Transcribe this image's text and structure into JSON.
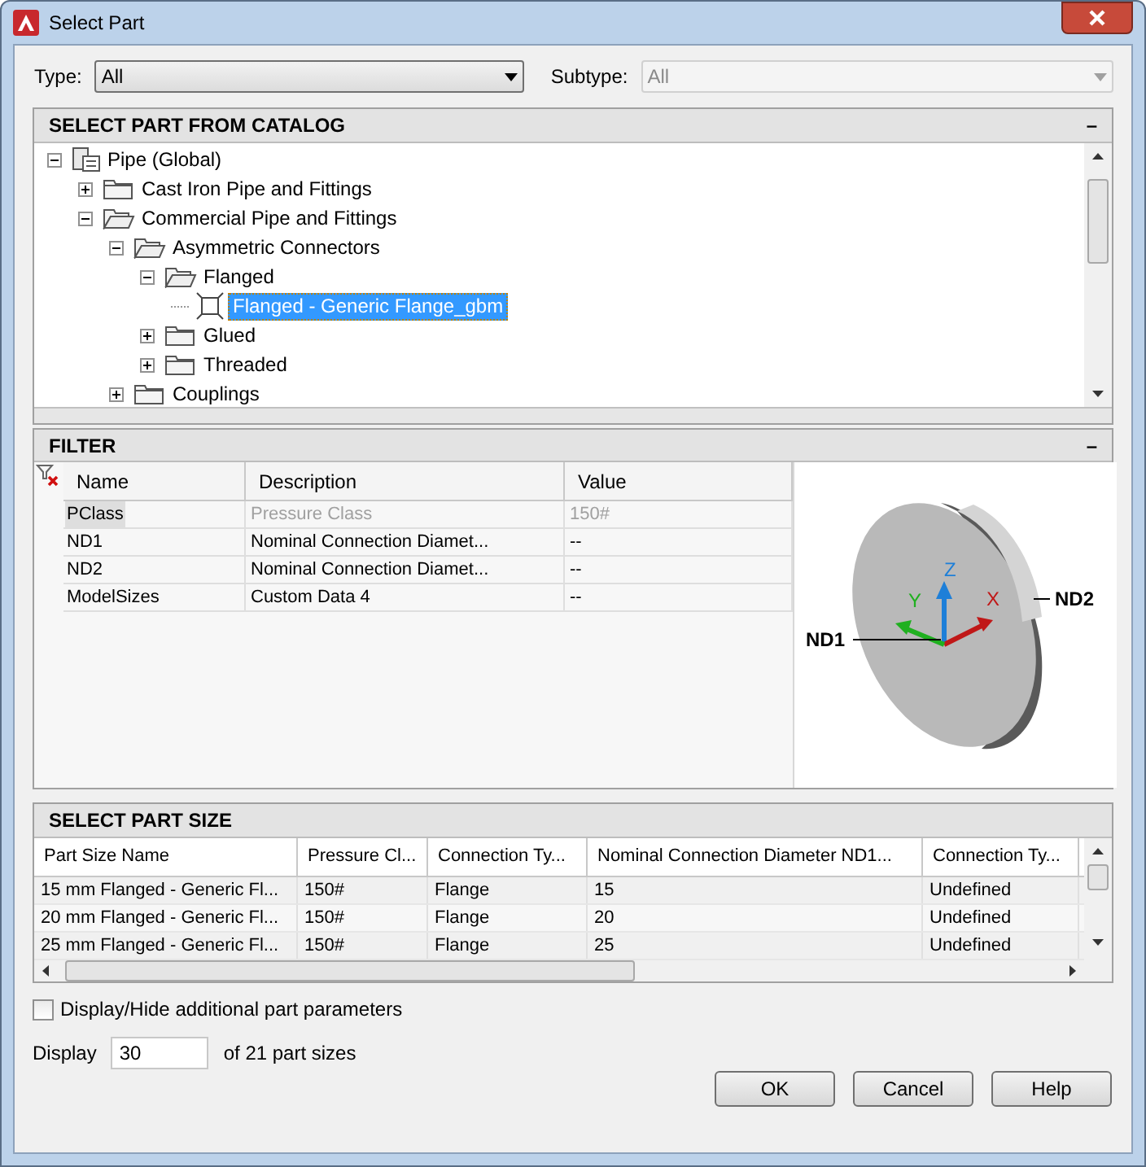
{
  "window": {
    "title": "Select Part"
  },
  "type": {
    "label": "Type:",
    "value": "All"
  },
  "subtype": {
    "label": "Subtype:",
    "value": "All",
    "disabled": true
  },
  "catalog": {
    "title": "SELECT PART FROM CATALOG",
    "collapse": "–",
    "tree": [
      {
        "label": "Pipe (Global)",
        "kind": "root",
        "expanded": true,
        "selected": false,
        "children": [
          {
            "label": "Cast Iron Pipe and Fittings",
            "kind": "folder",
            "expanded": false,
            "selected": false
          },
          {
            "label": "Commercial Pipe and Fittings",
            "kind": "folder",
            "expanded": true,
            "selected": false,
            "children": [
              {
                "label": "Asymmetric Connectors",
                "kind": "folder",
                "expanded": true,
                "selected": false,
                "children": [
                  {
                    "label": "Flanged",
                    "kind": "folder",
                    "expanded": true,
                    "selected": false,
                    "children": [
                      {
                        "label": "Flanged - Generic Flange_gbm",
                        "kind": "part",
                        "selected": true
                      }
                    ]
                  },
                  {
                    "label": "Glued",
                    "kind": "folder",
                    "expanded": false,
                    "selected": false
                  },
                  {
                    "label": "Threaded",
                    "kind": "folder",
                    "expanded": false,
                    "selected": false
                  }
                ]
              },
              {
                "label": "Couplings",
                "kind": "folder",
                "expanded": false,
                "selected": false
              }
            ]
          }
        ]
      }
    ]
  },
  "filter": {
    "title": "FILTER",
    "collapse": "–",
    "columns": [
      "Name",
      "Description",
      "Value"
    ],
    "rows": [
      {
        "cells": [
          "PClass",
          "Pressure Class",
          "150#"
        ],
        "disabled": true
      },
      {
        "cells": [
          "ND1",
          "Nominal Connection Diamet...",
          "--"
        ],
        "disabled": false
      },
      {
        "cells": [
          "ND2",
          "Nominal Connection Diamet...",
          "--"
        ],
        "disabled": false
      },
      {
        "cells": [
          "ModelSizes",
          "Custom Data 4",
          "--"
        ],
        "disabled": false
      }
    ],
    "preview": {
      "axes": [
        "X",
        "Y",
        "Z"
      ],
      "labels": [
        "ND1",
        "ND2"
      ]
    }
  },
  "part_size": {
    "title": "SELECT PART SIZE",
    "columns": [
      "Part Size Name",
      "Pressure Cl...",
      "Connection Ty...",
      "Nominal Connection Diameter ND1...",
      "Connection Ty..."
    ],
    "rows": [
      [
        "15 mm Flanged - Generic Fl...",
        "150#",
        "Flange",
        "15",
        "Undefined"
      ],
      [
        "20 mm Flanged - Generic Fl...",
        "150#",
        "Flange",
        "20",
        "Undefined"
      ],
      [
        "25 mm Flanged - Generic Fl...",
        "150#",
        "Flange",
        "25",
        "Undefined"
      ]
    ]
  },
  "additional_params": {
    "label": "Display/Hide additional part parameters",
    "checked": false
  },
  "display": {
    "label": "Display",
    "value": "30",
    "suffix": "of 21 part sizes"
  },
  "buttons": [
    "OK",
    "Cancel",
    "Help"
  ]
}
